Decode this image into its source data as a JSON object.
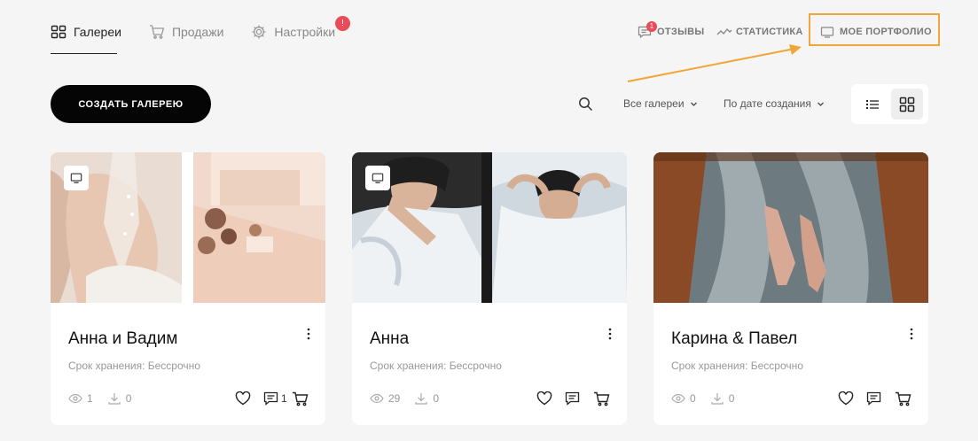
{
  "nav": {
    "tabs": [
      {
        "label": "Галереи",
        "icon": "grid-icon",
        "active": true
      },
      {
        "label": "Продажи",
        "icon": "cart-icon",
        "active": false
      },
      {
        "label": "Настройки",
        "icon": "gear-icon",
        "active": false
      }
    ],
    "settings_badge": "!",
    "links": [
      {
        "label": "ОТЗЫВЫ",
        "icon": "chat-icon",
        "badge": "1"
      },
      {
        "label": "СТАТИСТИКА",
        "icon": "trend-icon"
      },
      {
        "label": "МОЕ ПОРТФОЛИО",
        "icon": "monitor-icon"
      }
    ],
    "highlight_color": "#f0a63b"
  },
  "toolbar": {
    "create_label": "СОЗДАТЬ ГАЛЕРЕЮ",
    "filter_label": "Все галереи",
    "sort_label": "По дате создания",
    "view_mode": "grid"
  },
  "cards": [
    {
      "title": "Анна и Вадим",
      "storage": "Срок хранения: Бессрочно",
      "views": "1",
      "downloads": "0",
      "comments": "1"
    },
    {
      "title": "Анна",
      "storage": "Срок хранения: Бессрочно",
      "views": "29",
      "downloads": "0",
      "comments": ""
    },
    {
      "title": "Карина & Павел",
      "storage": "Срок хранения: Бессрочно",
      "views": "0",
      "downloads": "0",
      "comments": ""
    }
  ],
  "colors": {
    "badge": "#e94b58",
    "button": "#050505",
    "accent": "#f0a63b"
  }
}
